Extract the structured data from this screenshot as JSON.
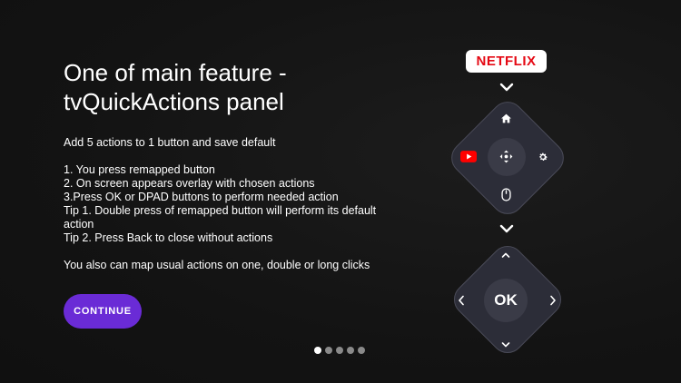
{
  "title": "One of main feature -\ntvQuickActions panel",
  "body": "Add 5 actions to 1 button and save default\n\n1. You press remapped button\n2. On screen appears overlay with chosen actions\n3.Press OK or DPAD buttons to perform needed action\nTip 1. Double press of remapped button will perform its default action\nTip 2. Press Back to close without actions\n\nYou also can map usual actions on one, double or long clicks",
  "continue_label": "CONTINUE",
  "netflix_label": "NETFLIX",
  "ok_label": "OK",
  "pager": {
    "total": 5,
    "active": 0
  },
  "colors": {
    "accent": "#6a2bd6",
    "netflix": "#e50914",
    "youtube": "#ff0000",
    "diamond": "#2c2d38"
  },
  "icons": [
    "chevron-down-icon",
    "home-icon",
    "youtube-icon",
    "dpad-move-icon",
    "gear-icon",
    "mouse-icon",
    "chevron-up-icon",
    "chevron-left-icon",
    "chevron-right-icon"
  ]
}
